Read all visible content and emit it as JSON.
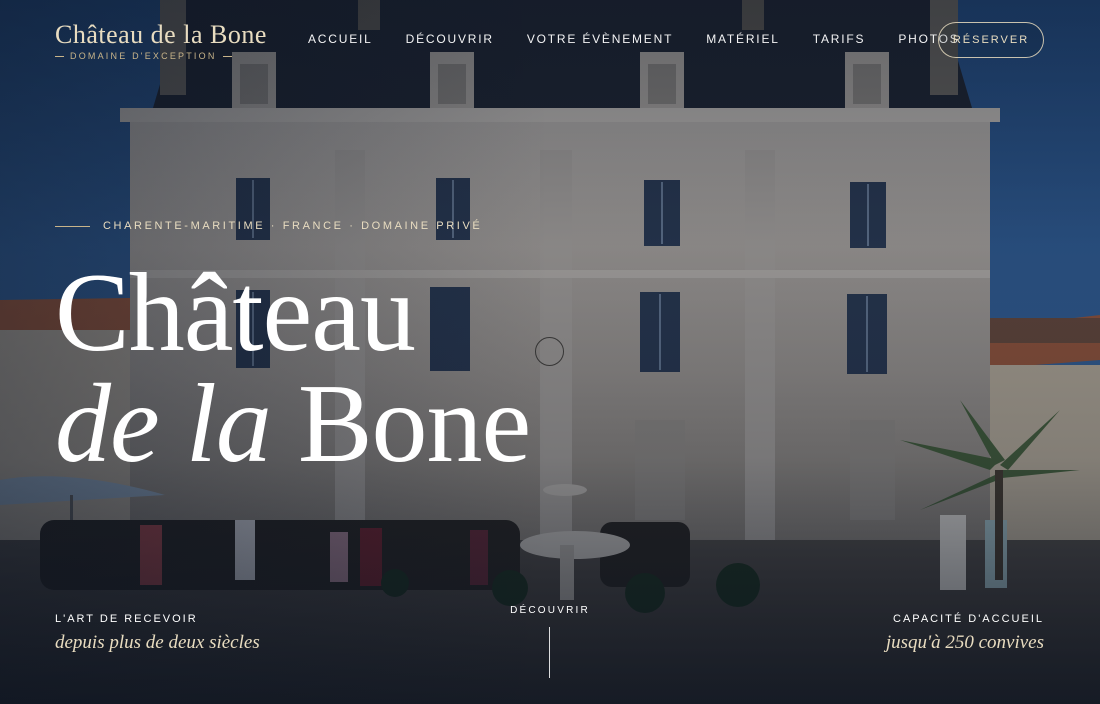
{
  "brand": {
    "name": "Château de la Bone",
    "tagline": "DOMAINE D'EXCEPTION"
  },
  "nav": {
    "items": [
      {
        "label": "ACCUEIL"
      },
      {
        "label": "DÉCOUVRIR"
      },
      {
        "label": "VOTRE ÉVÈNEMENT"
      },
      {
        "label": "MATÉRIEL"
      },
      {
        "label": "TARIFS"
      },
      {
        "label": "PHOTOS"
      }
    ],
    "cta_label": "RÉSERVER"
  },
  "hero": {
    "eyebrow": "CHARENTE-MARITIME · FRANCE · DOMAINE PRIVÉ",
    "title_line1": "Château",
    "title_line2_italic": "de la",
    "title_line2_regular": "Bone"
  },
  "footer": {
    "left_label": "L'ART DE RECEVOIR",
    "left_value": "depuis plus de deux siècles",
    "scroll_label": "DÉCOUVRIR",
    "right_label": "CAPACITÉ D'ACCUEIL",
    "right_value": "jusqu'à 250 convives"
  },
  "colors": {
    "gold": "#c8b48a",
    "cream": "#e8dcc0",
    "sky": "#2c5b94"
  }
}
